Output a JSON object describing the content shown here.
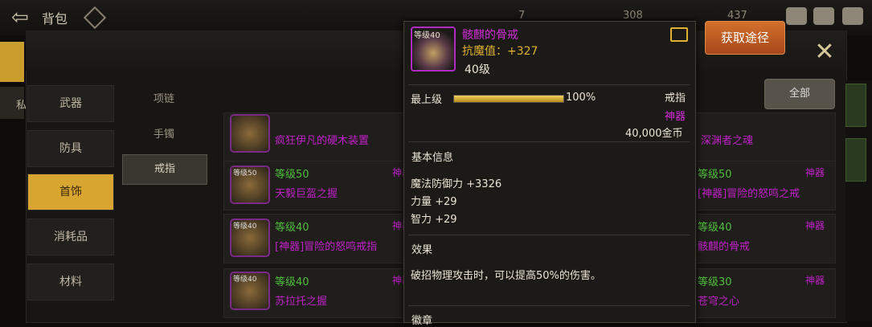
{
  "topbar": {
    "title": "背包",
    "res1": "7",
    "res2": "308",
    "res3": "437"
  },
  "edge_label": "私",
  "categories": [
    {
      "label": "武器",
      "active": false
    },
    {
      "label": "防具",
      "active": false
    },
    {
      "label": "首饰",
      "active": true
    },
    {
      "label": "消耗品",
      "active": false
    },
    {
      "label": "材料",
      "active": false
    }
  ],
  "subcategories": [
    {
      "label": "项链",
      "active": false
    },
    {
      "label": "手镯",
      "active": false
    },
    {
      "label": "戒指",
      "active": true
    }
  ],
  "get_button": "获取途径",
  "all_button": "全部",
  "rows": [
    {
      "level": "",
      "name": "疯狂伊凡的硬木装置",
      "right_name": "深渊者之魂",
      "right_level": "",
      "tag": ""
    },
    {
      "level": "等级50",
      "name": "天毅巨盔之握",
      "right_name": "[神器]冒险的怒鸣之戒",
      "right_level": "等级50",
      "tag": "神器"
    },
    {
      "level": "等级40",
      "name": "[神器]冒险的怒鸣戒指",
      "right_name": "骸麒的骨戒",
      "right_level": "等级40",
      "tag": "神器"
    },
    {
      "level": "等级40",
      "name": "苏拉托之握",
      "right_name": "苍穹之心",
      "right_level": "等级30",
      "tag": "神器"
    }
  ],
  "tooltip": {
    "icon_level": "等级40",
    "name": "骸麒的骨戒",
    "stat": "抗魔值：+327",
    "level": "40级",
    "max_label": "最上级",
    "progress_percent": 100,
    "progress_text": "100%",
    "item_type": "戒指",
    "rarity": "神器",
    "price": "40,000金币",
    "basic_title": "基本信息",
    "basic_lines": [
      "魔法防御力 +3326",
      "力量 +29",
      "智力 +29"
    ],
    "effect_title": "效果",
    "effect_text": "破招物理攻击时，可以提高50%的伤害。",
    "bottom_title": "徽章"
  },
  "colors": {
    "accent_gold": "#d9a531",
    "artifact_purple": "#d42cd8",
    "level_green": "#4fbf3c",
    "orange_button": "#c85e24"
  },
  "icons": [
    "back-arrow-icon",
    "diamond-icon",
    "close-icon",
    "share-icon",
    "chest-icon",
    "mail-icon",
    "chat-icon"
  ]
}
